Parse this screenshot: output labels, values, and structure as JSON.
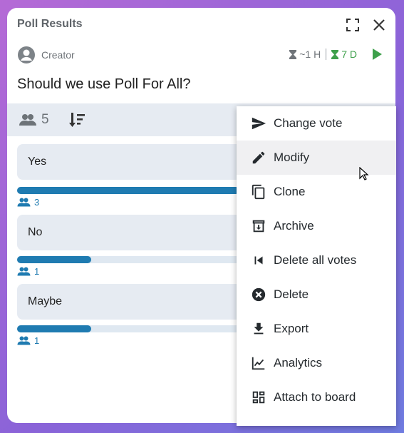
{
  "header": {
    "title": "Poll Results"
  },
  "creator": {
    "label": "Creator"
  },
  "timers": {
    "remaining": "~1 H",
    "duration": "7 D"
  },
  "question": "Should we use Poll For All?",
  "toolbar": {
    "participants": "5"
  },
  "options": [
    {
      "label": "Yes",
      "votes": "3",
      "fraction": 0.6
    },
    {
      "label": "No",
      "votes": "1",
      "fraction": 0.2
    },
    {
      "label": "Maybe",
      "votes": "1",
      "fraction": 0.2
    }
  ],
  "menu": {
    "items": [
      {
        "label": "Change vote",
        "icon": "send-icon"
      },
      {
        "label": "Modify",
        "icon": "pencil-icon"
      },
      {
        "label": "Clone",
        "icon": "copy-icon"
      },
      {
        "label": "Archive",
        "icon": "archive-icon"
      },
      {
        "label": "Delete all votes",
        "icon": "skip-previous-icon"
      },
      {
        "label": "Delete",
        "icon": "delete-circle-icon"
      },
      {
        "label": "Export",
        "icon": "download-icon"
      },
      {
        "label": "Analytics",
        "icon": "chart-icon"
      },
      {
        "label": "Attach to board",
        "icon": "dashboard-icon"
      }
    ]
  },
  "colors": {
    "accent": "#1f7bb1",
    "green": "#3ea04b",
    "track": "#dfe8f1",
    "panel": "#e6ebf2"
  }
}
